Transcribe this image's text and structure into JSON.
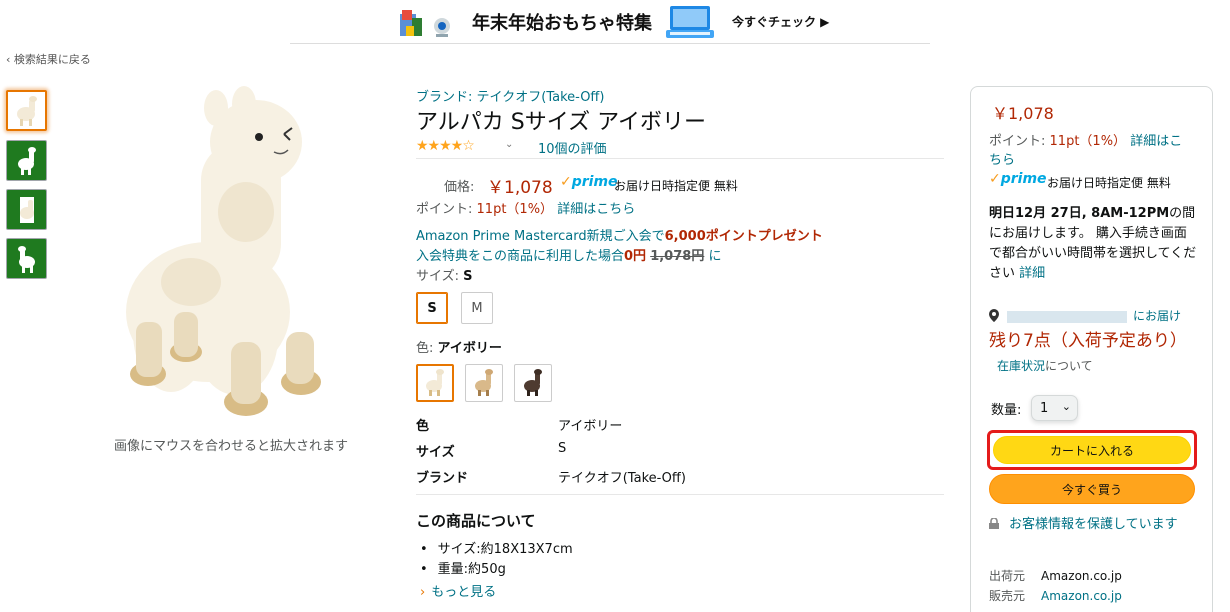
{
  "banner": {
    "title": "年末年始おもちゃ特集",
    "cta": "今すぐチェック ▶"
  },
  "nav": {
    "back": "‹ 検索結果に戻る"
  },
  "gallery": {
    "zoom_hint": "画像にマウスを合わせると拡大されます"
  },
  "product": {
    "brand": "ブランド: テイクオフ(Take-Off)",
    "title": "アルパカ Sサイズ アイボリー",
    "stars": "★★★★☆",
    "rating": 4,
    "ratings_count": "10個の評価",
    "price_label": "価格:",
    "price": "￥1,078",
    "prime": "prime",
    "prime_check": "✓",
    "delivery_note": "お届け日時指定便 無料",
    "points_label": "ポイント:",
    "points_value": "11pt（1%）",
    "points_link": "詳細はこちら",
    "promo_line1_a": "Amazon Prime Mastercard新規ご入会で",
    "promo_line1_b": "6,000ポイントプレゼント",
    "promo_line2_a": "入会特典をこの商品に利用した場合",
    "promo_line2_b": "0円",
    "promo_line2_c": "1,078円",
    "promo_line2_d": "に",
    "size_label": "サイズ:",
    "size_selected": "S",
    "sizes": [
      "S",
      "M"
    ],
    "color_label": "色:",
    "color_selected": "アイボリー",
    "specs": [
      {
        "key": "色",
        "value": "アイボリー"
      },
      {
        "key": "サイズ",
        "value": "S"
      },
      {
        "key": "ブランド",
        "value": "テイクオフ(Take-Off)"
      }
    ],
    "about_title": "この商品について",
    "bullets": [
      "サイズ:約18X13X7cm",
      "重量:約50g"
    ],
    "more": "もっと見る"
  },
  "buybox": {
    "price": "￥1,078",
    "points_label": "ポイント:",
    "points_value": "11pt（1%）",
    "points_link": "詳細はこちら",
    "prime": "prime",
    "prime_note": "お届け日時指定便 無料",
    "delivery_bold": "明日12月 27日, 8AM-12PM",
    "delivery_rest": "の間にお届けします。 購入手続き画面で都合がいい時間帯を選択してください",
    "delivery_link": "詳細",
    "location_suffix": "にお届け",
    "stock": "残り7点（入荷予定あり）",
    "stock_note_link": "在庫状況",
    "stock_note_rest": "について",
    "qty_label": "数量:",
    "qty_value": "1",
    "add_to_cart": "カートに入れる",
    "buy_now": "今すぐ買う",
    "secure": "お客様情報を保護しています",
    "shipper_label": "出荷元",
    "shipper": "Amazon.co.jp",
    "seller_label": "販売元",
    "seller": "Amazon.co.jp"
  },
  "colors": {
    "price": "#b12704",
    "link": "#007185",
    "cart_button": "#ffd814",
    "buy_button": "#ffa41c",
    "highlight_outline": "#e41b1b",
    "selected_border": "#e77600",
    "prime_blue": "#00a8e1"
  },
  "icons": {
    "back": "chevron-left-icon",
    "location": "location-pin-icon",
    "lock": "lock-icon",
    "more": "chevron-right-icon",
    "caret": "chevron-down-icon"
  }
}
